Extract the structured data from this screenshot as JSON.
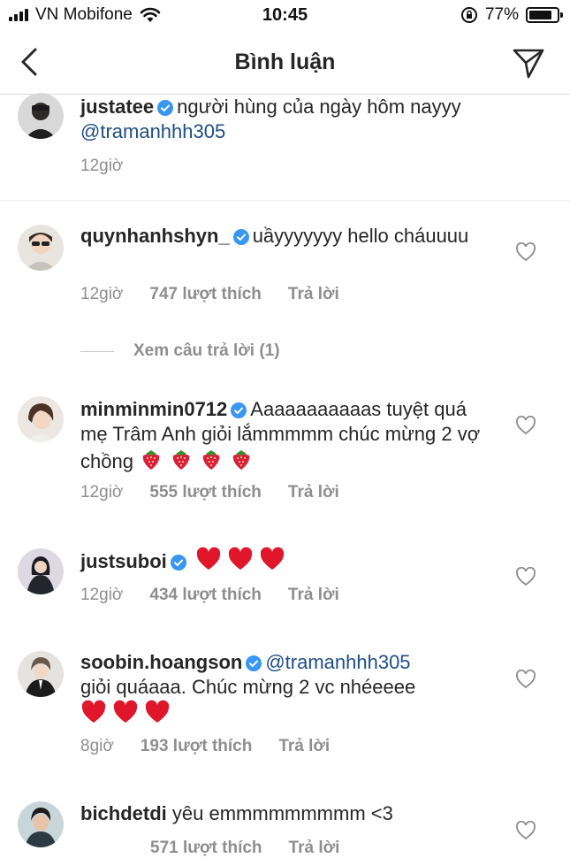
{
  "status_bar": {
    "carrier": "VN Mobifone",
    "time": "10:45",
    "battery_percent": "77%",
    "battery_level": 0.77
  },
  "header": {
    "title": "Bình luận"
  },
  "comments": [
    {
      "username": "justatee",
      "text_before": "người hùng của ngày hôm nayyy ",
      "mention": "@tramanhhh305",
      "time": "12giờ"
    },
    {
      "username": "quynhanhshyn_",
      "text": "uầyyyyyyy hello cháuuuu",
      "time": "12giờ",
      "likes": "747 lượt thích",
      "reply": "Trả lời",
      "view_replies": "Xem câu trả lời (1)"
    },
    {
      "username": "minminmin0712",
      "text": "Aaaaaaaaaaas tuyệt quá mẹ Trâm Anh giỏi lắmmmmm chúc mừng 2 vợ chồng",
      "emoji": "strawberry",
      "emoji_count": 4,
      "time": "12giờ",
      "likes": "555 lượt thích",
      "reply": "Trả lời"
    },
    {
      "username": "justsuboi",
      "emoji": "red-heart",
      "emoji_count": 3,
      "time": "12giờ",
      "likes": "434 lượt thích",
      "reply": "Trả lời"
    },
    {
      "username": "soobin.hoangson",
      "mention": "@tramanhhh305",
      "text": "giỏi quáaaa. Chúc mừng 2 vc nhéeeee",
      "emoji": "red-heart",
      "emoji_count": 3,
      "time": "8giờ",
      "likes": "193 lượt thích",
      "reply": "Trả lời"
    },
    {
      "username": "bichdetdi",
      "text": "yêu emmmmmmmmm <3",
      "time": "",
      "likes": "571 lượt thích",
      "reply": "Trả lời"
    }
  ],
  "colors": {
    "text": "#262626",
    "secondary": "#8e8e8e",
    "mention": "#1e4d86",
    "verified": "#3897f0",
    "heart_emoji": "#e0162b"
  }
}
